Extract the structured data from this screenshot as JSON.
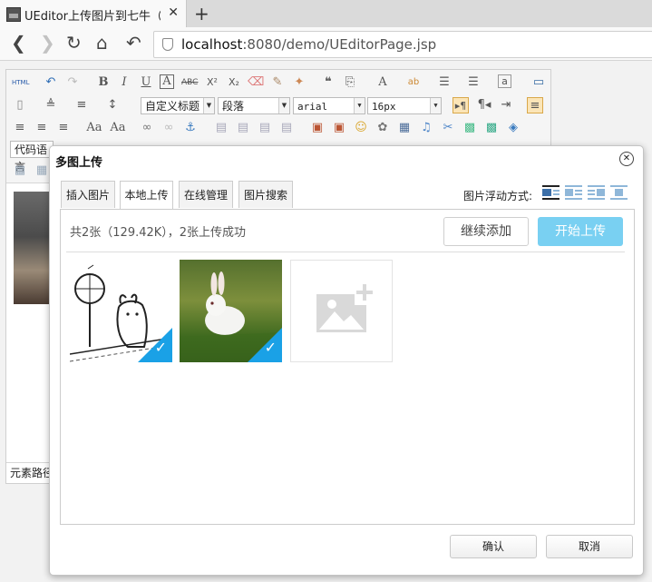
{
  "browser": {
    "tab_title": "UEditor上传图片到七牛（ja",
    "tab_close": "✕",
    "new_tab": "+",
    "url_host": "localhost",
    "url_rest": ":8080/demo/UEditorPage.jsp"
  },
  "toolbar": {
    "row1": [
      "HTML",
      "↶",
      "↷",
      "B",
      "I",
      "U",
      "A",
      "ABC",
      "X²",
      "X₂",
      "⌫",
      "✎",
      "✦",
      "❝",
      "⎘",
      "A",
      "ab",
      "☰",
      "☰",
      "a",
      "▭"
    ],
    "custom_heading": "自定义标题",
    "paragraph": "段落",
    "font_family": "arial",
    "font_size": "16px",
    "code_lang": "代码语言"
  },
  "editor": {
    "element_path": "元素路径"
  },
  "dialog": {
    "title": "多图上传",
    "close": "✕",
    "tabs": [
      "插入图片",
      "本地上传",
      "在线管理",
      "图片搜索"
    ],
    "active_tab": "本地上传",
    "float_label": "图片浮动方式:",
    "status": "共2张（129.42K），2张上传成功",
    "continue_button": "继续添加",
    "start_button": "开始上传",
    "confirm_button": "确认",
    "cancel_button": "取消",
    "images": [
      {
        "name": "cartoon-rabbit-image",
        "checked": true
      },
      {
        "name": "white-rabbit-image",
        "checked": true
      }
    ]
  },
  "colors": {
    "accent": "#1aa1e6",
    "start_button": "#79d0f2",
    "active_toolbar": "#fbe5b7"
  }
}
